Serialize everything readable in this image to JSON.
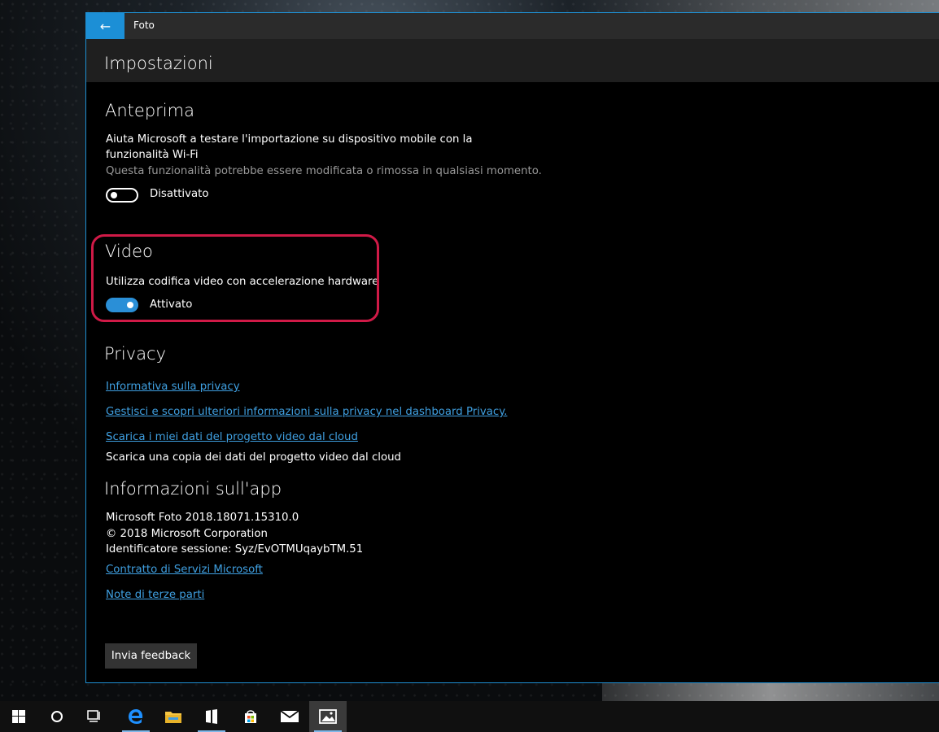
{
  "window": {
    "app_title": "Foto",
    "page_title": "Impostazioni"
  },
  "preview": {
    "title": "Anteprima",
    "description": "Aiuta Microsoft a testare l'importazione su dispositivo mobile con la funzionalità Wi-Fi",
    "note": "Questa funzionalità potrebbe essere modificata o rimossa in qualsiasi momento.",
    "toggle_label": "Disattivato",
    "toggle_on": false
  },
  "video": {
    "title": "Video",
    "description": "Utilizza codifica video con accelerazione hardware",
    "toggle_label": "Attivato",
    "toggle_on": true
  },
  "privacy": {
    "title": "Privacy",
    "links": [
      "Informativa sulla privacy",
      "Gestisci e scopri ulteriori informazioni sulla privacy nel dashboard Privacy.",
      "Scarica i miei dati del progetto video dal cloud"
    ],
    "download_note": "Scarica una copia dei dati del progetto video dal cloud"
  },
  "about": {
    "title": "Informazioni sull'app",
    "version": "Microsoft Foto 2018.18071.15310.0",
    "copyright": "© 2018 Microsoft Corporation",
    "session": "Identificatore sessione: Syz/EvOTMUqaybTM.51",
    "links": [
      "Contratto di Servizi Microsoft",
      "Note di terze parti"
    ]
  },
  "feedback_button": "Invia feedback",
  "taskbar": {
    "items": [
      "windows-start-icon",
      "cortana-search-icon",
      "task-view-icon",
      "edge-browser-icon",
      "file-explorer-icon",
      "media-app-icon",
      "store-icon",
      "mail-icon",
      "photos-app-icon"
    ]
  },
  "colors": {
    "accent": "#1c8fd6",
    "link": "#3f9fe0",
    "highlight": "#d01a47"
  }
}
